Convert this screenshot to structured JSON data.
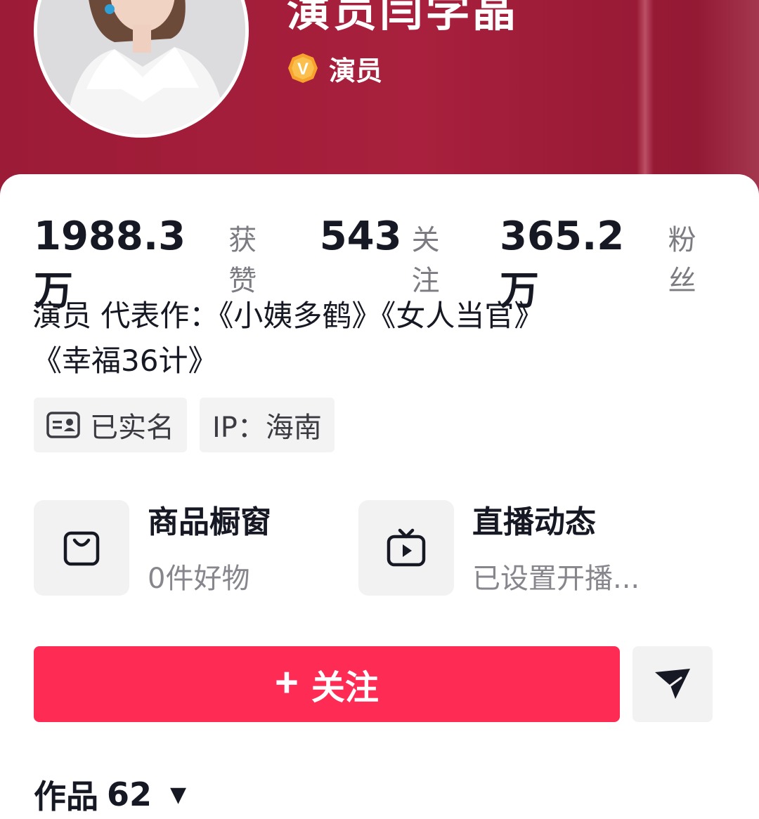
{
  "profile": {
    "name": "演员闫学晶",
    "verify_badge": "V",
    "verify_label": "演员",
    "colors": {
      "header": "#a01f3b",
      "verify_badge": "#f7a22c",
      "primary": "#fe2c55"
    }
  },
  "stats": [
    {
      "value": "1988.3万",
      "label": "获赞"
    },
    {
      "value": "543",
      "label": "关注"
    },
    {
      "value": "365.2万",
      "label": "粉丝"
    }
  ],
  "bio": {
    "line1": "演员 代表作：《小姨多鹤》《女人当官》",
    "line2": "《幸福36计》"
  },
  "tags": {
    "real_name": {
      "icon": "id-card-icon",
      "label": "已实名"
    },
    "ip": "IP：海南"
  },
  "features": [
    {
      "icon": "shopping-bag-icon",
      "title": "商品橱窗",
      "subtitle": "0件好物"
    },
    {
      "icon": "tv-play-icon",
      "title": "直播动态",
      "subtitle": "已设置开播..."
    }
  ],
  "actions": {
    "follow_icon": "plus-icon",
    "follow_label": "关注",
    "share_icon": "paper-plane-icon"
  },
  "works_tab": {
    "label": "作品",
    "count": "62",
    "icon": "caret-down-icon"
  }
}
